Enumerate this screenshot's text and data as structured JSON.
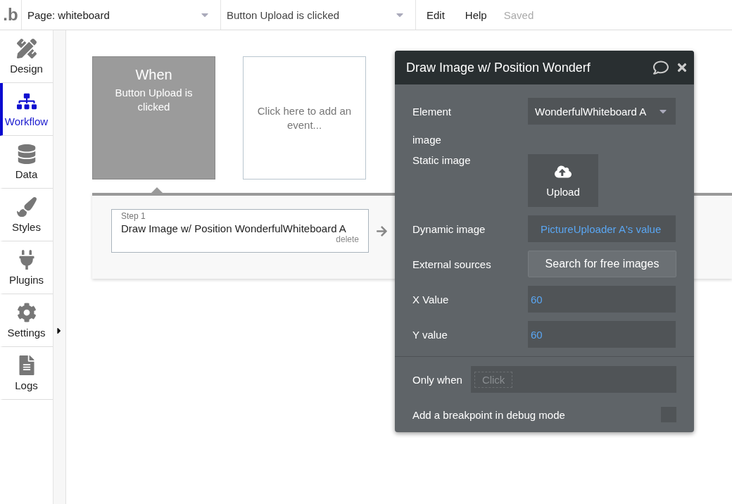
{
  "topbar": {
    "logo": ".b",
    "page_select": "Page: whiteboard",
    "event_select": "Button Upload is clicked",
    "menu": [
      "Edit",
      "Help"
    ],
    "status": "Saved"
  },
  "sidebar": {
    "items": [
      {
        "label": "Design",
        "selected": false
      },
      {
        "label": "Workflow",
        "selected": true
      },
      {
        "label": "Data",
        "selected": false
      },
      {
        "label": "Styles",
        "selected": false
      },
      {
        "label": "Plugins",
        "selected": false
      },
      {
        "label": "Settings",
        "selected": false
      },
      {
        "label": "Logs",
        "selected": false
      }
    ]
  },
  "events": [
    {
      "kind": "trigger",
      "title": "When",
      "text": "Button Upload is clicked",
      "selected": true
    },
    {
      "kind": "add",
      "text": "Click here to add an event..."
    }
  ],
  "steps": [
    {
      "label": "Step 1",
      "title": "Draw Image w/ Position WonderfulWhiteboard A",
      "delete": "delete"
    }
  ],
  "popup": {
    "title": "Draw Image w/ Position Wonderf",
    "rows": [
      {
        "kind": "dropdown",
        "label": "Element",
        "value": "WonderfulWhiteboard A"
      },
      {
        "kind": "heading",
        "label": "image"
      },
      {
        "kind": "upload",
        "label": "Static image",
        "value": "Upload"
      },
      {
        "kind": "expression",
        "label": "Dynamic image",
        "value": "PictureUploader A's value"
      },
      {
        "kind": "button",
        "label": "External sources",
        "value": "Search for free images"
      },
      {
        "kind": "expression",
        "label": "X Value",
        "value": "60"
      },
      {
        "kind": "expression",
        "label": "Y value",
        "value": "60"
      }
    ],
    "condition": {
      "label": "Only when",
      "placeholder": "Click"
    },
    "breakpoint": {
      "label": "Add a breakpoint in debug mode",
      "checked": false
    }
  }
}
